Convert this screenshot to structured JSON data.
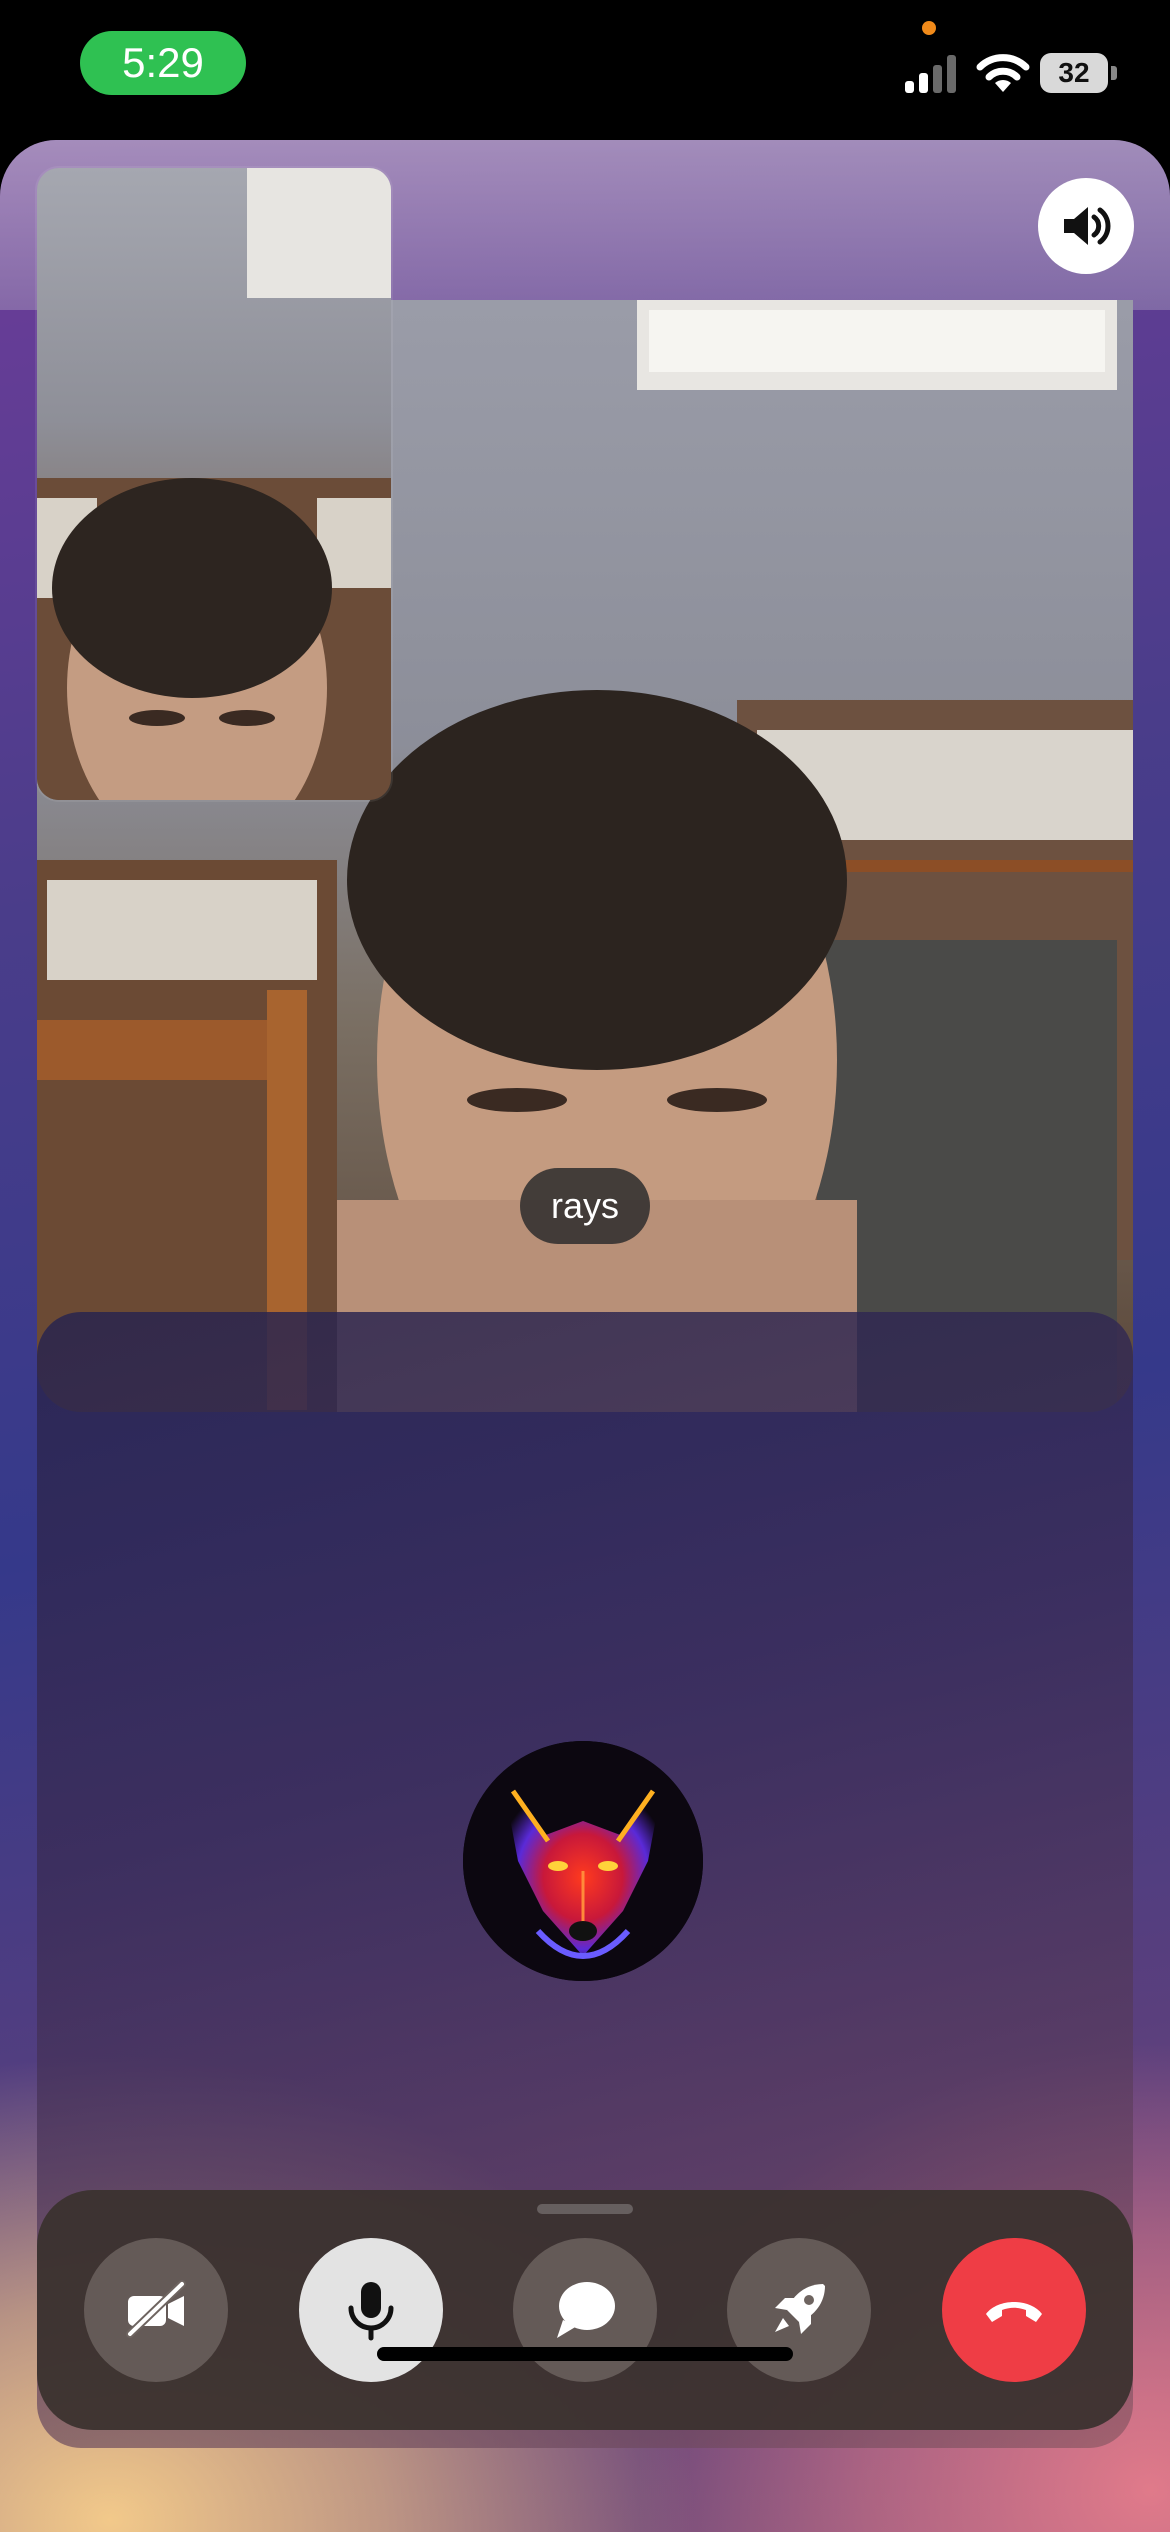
{
  "status_bar": {
    "time": "5:29",
    "battery": "32"
  },
  "call": {
    "remote_name": "rays",
    "controls": [
      {
        "icon": "video-off-icon"
      },
      {
        "icon": "microphone-icon"
      },
      {
        "icon": "chat-bubble-icon"
      },
      {
        "icon": "rocket-icon"
      },
      {
        "icon": "end-call-icon"
      }
    ]
  },
  "colors": {
    "time_pill": "#2fc152",
    "end_call": "#ef3d45",
    "mic_active": "#e3e3e3"
  }
}
